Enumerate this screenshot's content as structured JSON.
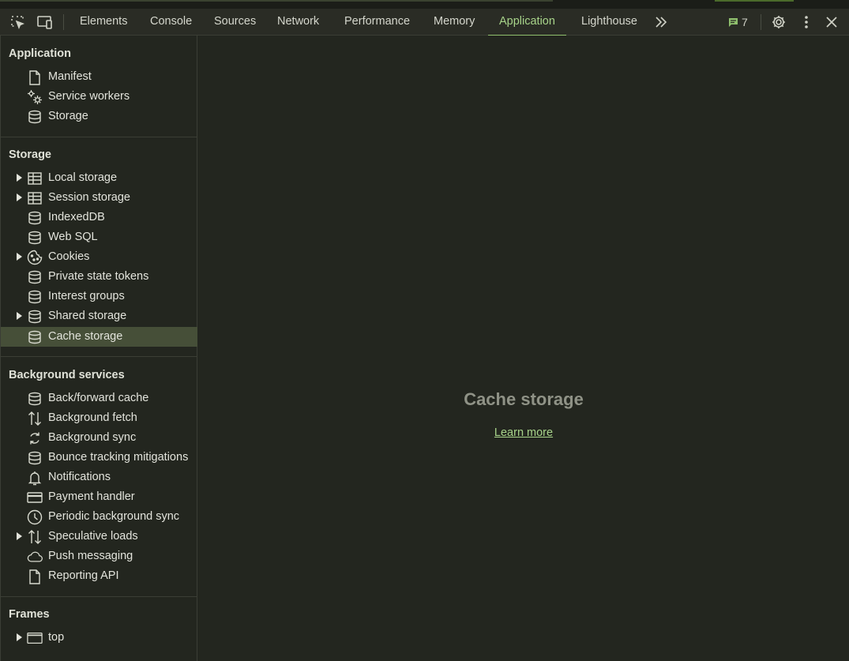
{
  "toolbar": {
    "tabs": [
      {
        "label": "Elements"
      },
      {
        "label": "Console"
      },
      {
        "label": "Sources"
      },
      {
        "label": "Network"
      },
      {
        "label": "Performance"
      },
      {
        "label": "Memory"
      },
      {
        "label": "Application"
      },
      {
        "label": "Lighthouse"
      }
    ],
    "active_tab": "Application",
    "issues_count": "7",
    "icons": [
      "inspect-element-icon",
      "device-toolbar-icon",
      "more-tabs-icon",
      "issues-icon",
      "settings-icon",
      "kebab-menu-icon",
      "close-icon"
    ]
  },
  "sidebar": {
    "application": {
      "title": "Application",
      "items": [
        {
          "label": "Manifest",
          "icon": "document-icon"
        },
        {
          "label": "Service workers",
          "icon": "gears-icon"
        },
        {
          "label": "Storage",
          "icon": "database-icon"
        }
      ]
    },
    "storage": {
      "title": "Storage",
      "items": [
        {
          "label": "Local storage",
          "icon": "table-icon",
          "expandable": true
        },
        {
          "label": "Session storage",
          "icon": "table-icon",
          "expandable": true
        },
        {
          "label": "IndexedDB",
          "icon": "database-icon"
        },
        {
          "label": "Web SQL",
          "icon": "database-icon"
        },
        {
          "label": "Cookies",
          "icon": "cookie-icon",
          "expandable": true
        },
        {
          "label": "Private state tokens",
          "icon": "database-icon"
        },
        {
          "label": "Interest groups",
          "icon": "database-icon"
        },
        {
          "label": "Shared storage",
          "icon": "database-icon",
          "expandable": true
        },
        {
          "label": "Cache storage",
          "icon": "database-icon",
          "selected": true
        }
      ]
    },
    "background": {
      "title": "Background services",
      "items": [
        {
          "label": "Back/forward cache",
          "icon": "database-icon"
        },
        {
          "label": "Background fetch",
          "icon": "up-down-arrows-icon"
        },
        {
          "label": "Background sync",
          "icon": "sync-icon"
        },
        {
          "label": "Bounce tracking mitigations",
          "icon": "database-icon"
        },
        {
          "label": "Notifications",
          "icon": "bell-icon"
        },
        {
          "label": "Payment handler",
          "icon": "credit-card-icon"
        },
        {
          "label": "Periodic background sync",
          "icon": "clock-icon"
        },
        {
          "label": "Speculative loads",
          "icon": "up-down-arrows-icon",
          "expandable": true
        },
        {
          "label": "Push messaging",
          "icon": "cloud-icon"
        },
        {
          "label": "Reporting API",
          "icon": "document-icon"
        }
      ]
    },
    "frames": {
      "title": "Frames",
      "items": [
        {
          "label": "top",
          "icon": "frame-icon",
          "expandable": true
        }
      ]
    }
  },
  "main": {
    "title": "Cache storage",
    "link": "Learn more"
  },
  "colors": {
    "background": "#23261f",
    "toolbar": "#2a2c25",
    "accent": "#a8d48a",
    "selected": "#464f38"
  }
}
